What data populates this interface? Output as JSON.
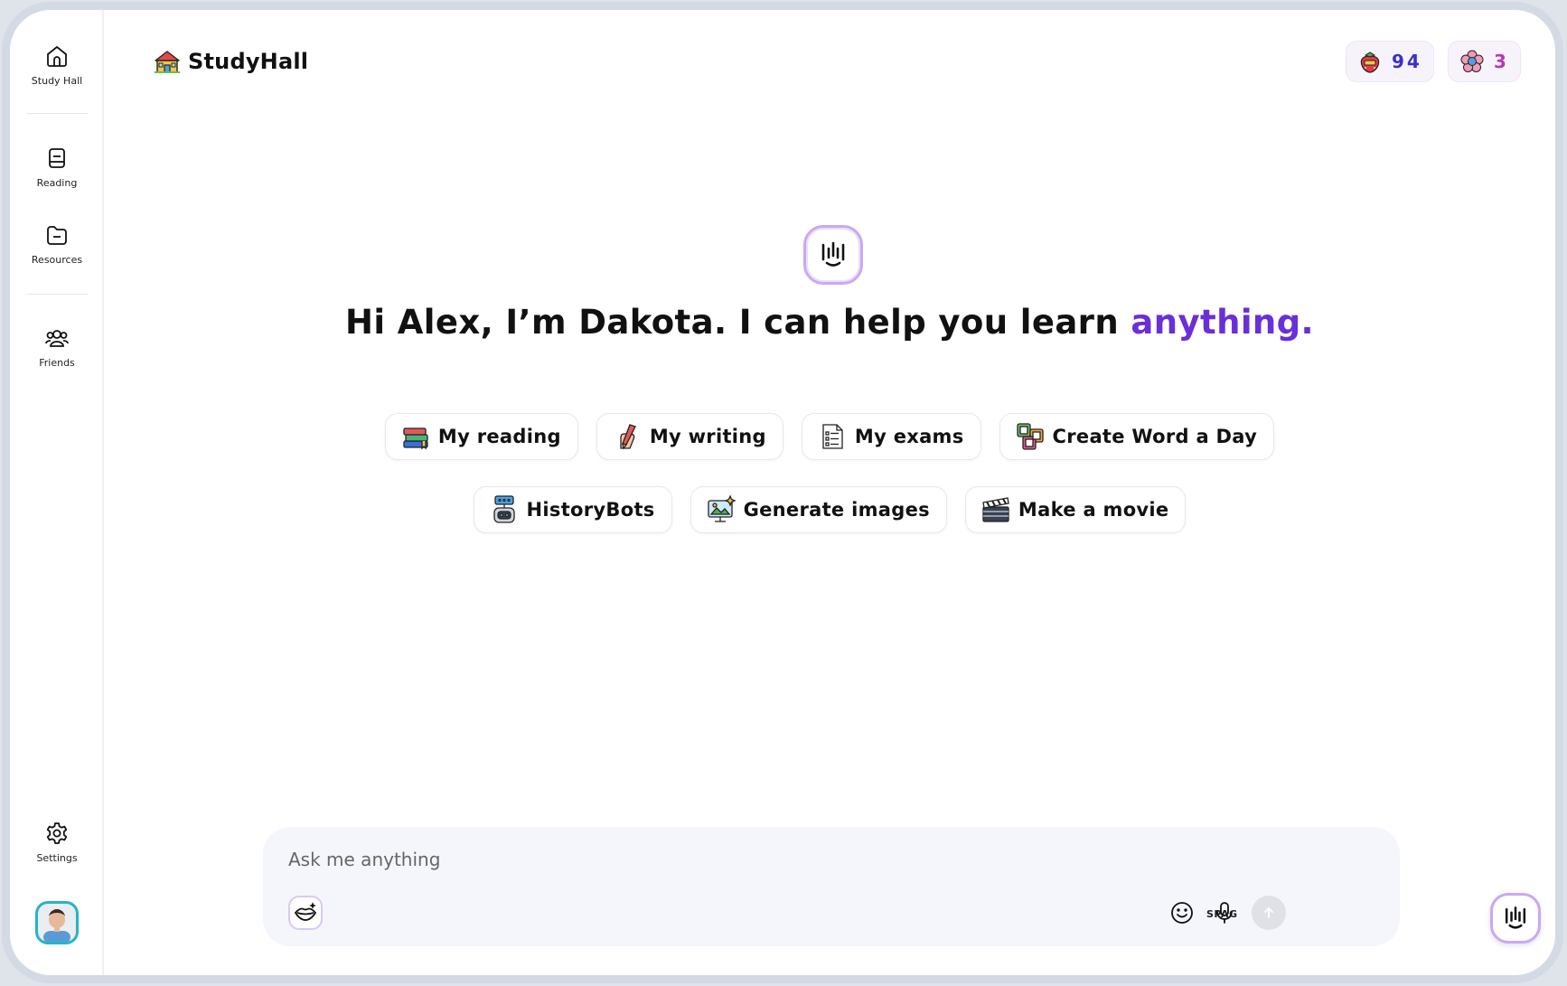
{
  "sidebar": {
    "items": [
      {
        "label": "Study Hall",
        "icon": "home-icon"
      },
      {
        "label": "Reading",
        "icon": "book-icon"
      },
      {
        "label": "Resources",
        "icon": "folder-icon"
      },
      {
        "label": "Friends",
        "icon": "friends-icon"
      },
      {
        "label": "Settings",
        "icon": "gear-icon"
      }
    ]
  },
  "brand": {
    "name": "StudyHall",
    "icon": "schoolhouse-icon"
  },
  "badges": [
    {
      "value": "94",
      "icon": "strawberry-icon",
      "color": "#3b2fc9"
    },
    {
      "value": "3",
      "icon": "flower-icon",
      "color": "#b43ab8"
    }
  ],
  "hero": {
    "greeting": "Hi Alex, I’m Dakota. I can help you learn ",
    "accent_word": "anything.",
    "accent_color": "#6a2fd8",
    "icon": "dakota-waveform-icon"
  },
  "chips_row1": [
    {
      "label": "My reading",
      "icon": "books-icon"
    },
    {
      "label": "My writing",
      "icon": "writing-hand-icon"
    },
    {
      "label": "My exams",
      "icon": "exam-sheet-icon"
    },
    {
      "label": "Create Word a Day",
      "icon": "word-blocks-icon"
    }
  ],
  "chips_row2": [
    {
      "label": "HistoryBots",
      "icon": "robot-icon"
    },
    {
      "label": "Generate images",
      "icon": "image-monitor-icon"
    },
    {
      "label": "Make a movie",
      "icon": "clapperboard-icon"
    }
  ],
  "composer": {
    "placeholder": "Ask me anything",
    "spag_label": "SPAG",
    "icons": [
      "lips-icon",
      "smiley-icon",
      "microphone-icon",
      "send-arrow-icon"
    ]
  }
}
